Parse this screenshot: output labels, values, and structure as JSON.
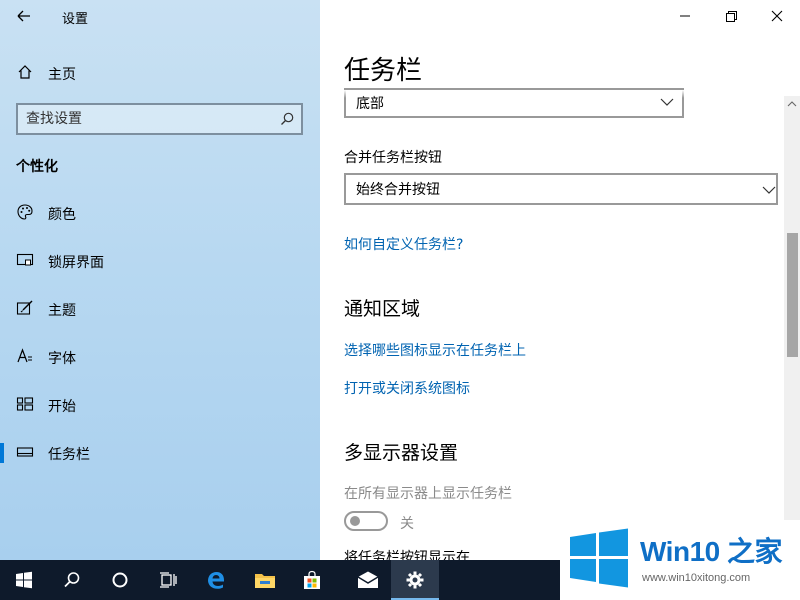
{
  "window": {
    "app_title": "设置",
    "back_icon": "arrow-left-icon",
    "minimize_icon": "minimize-icon",
    "restore_icon": "restore-icon",
    "close_icon": "close-icon"
  },
  "sidebar": {
    "home": {
      "label": "主页",
      "icon": "home-icon"
    },
    "search": {
      "placeholder": "查找设置",
      "icon": "search-icon"
    },
    "section": "个性化",
    "items": [
      {
        "label": "颜色",
        "icon": "palette-icon",
        "active": false
      },
      {
        "label": "锁屏界面",
        "icon": "lock-screen-icon",
        "active": false
      },
      {
        "label": "主题",
        "icon": "theme-brush-icon",
        "active": false
      },
      {
        "label": "字体",
        "icon": "font-icon",
        "active": false
      },
      {
        "label": "开始",
        "icon": "start-tiles-icon",
        "active": false
      },
      {
        "label": "任务栏",
        "icon": "taskbar-icon",
        "active": true
      }
    ],
    "accent": "#0078d7"
  },
  "content": {
    "title": "任务栏",
    "position_dropdown": {
      "value": "底部"
    },
    "combine_label": "合并任务栏按钮",
    "combine_dropdown": {
      "value": "始终合并按钮"
    },
    "customize_link": "如何自定义任务栏?",
    "notification_heading": "通知区域",
    "notification_links": [
      "选择哪些图标显示在任务栏上",
      "打开或关闭系统图标"
    ],
    "multi_display_heading": "多显示器设置",
    "multi_display_show_label": "在所有显示器上显示任务栏",
    "multi_display_toggle": {
      "state": "关",
      "on": false
    },
    "cutoff_label": "将任务栏按钮显示在",
    "link_color": "#0063b1"
  },
  "taskbar": {
    "buttons": [
      {
        "name": "start-button",
        "icon": "windows-logo-icon"
      },
      {
        "name": "search-button",
        "icon": "search-icon"
      },
      {
        "name": "cortana-button",
        "icon": "cortana-circle-icon"
      },
      {
        "name": "task-view-button",
        "icon": "task-view-icon"
      },
      {
        "name": "edge-button",
        "icon": "edge-icon"
      },
      {
        "name": "explorer-button",
        "icon": "folder-icon"
      },
      {
        "name": "store-button",
        "icon": "store-bag-icon"
      },
      {
        "name": "mail-button",
        "icon": "mail-icon"
      },
      {
        "name": "settings-button",
        "icon": "gear-icon",
        "active": true
      }
    ],
    "background": "#0e1a2b"
  },
  "watermark": {
    "brand_text": "Win10 之家",
    "url_text": "www.win10xitong.com"
  }
}
